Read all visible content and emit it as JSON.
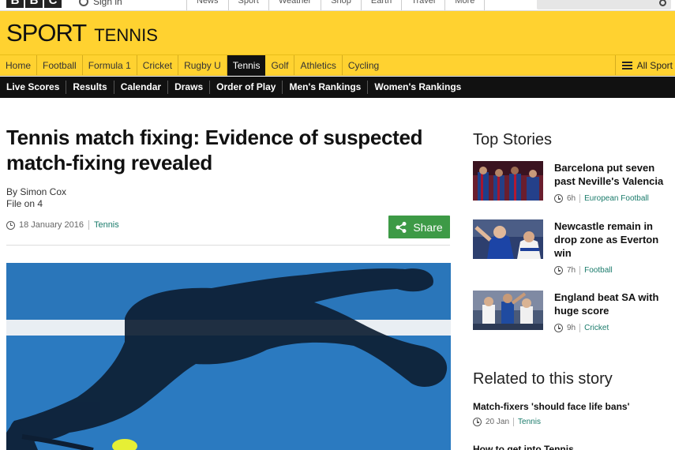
{
  "bbc_bar": {
    "logo": [
      "B",
      "B",
      "C"
    ],
    "signin": "Sign in",
    "nav": [
      "News",
      "Sport",
      "Weather",
      "Shop",
      "Earth",
      "Travel",
      "More"
    ],
    "search_placeholder": "Search"
  },
  "header": {
    "title": "SPORT",
    "section": "TENNIS"
  },
  "sport_nav": {
    "items": [
      "Home",
      "Football",
      "Formula 1",
      "Cricket",
      "Rugby U",
      "Tennis",
      "Golf",
      "Athletics",
      "Cycling"
    ],
    "active": "Tennis",
    "all_sport": "All Sport"
  },
  "sub_nav": {
    "items": [
      "Live Scores",
      "Results",
      "Calendar",
      "Draws",
      "Order of Play",
      "Men's Rankings",
      "Women's Rankings"
    ]
  },
  "article": {
    "title": "Tennis match fixing: Evidence of suspected match-fixing revealed",
    "author": "By Simon Cox",
    "programme": "File on 4",
    "date": "18 January 2016",
    "topic": "Tennis",
    "share_label": "Share"
  },
  "top_stories": {
    "heading": "Top Stories",
    "items": [
      {
        "headline": "Barcelona put seven past Neville's Valencia",
        "time": "6h",
        "topic": "European Football"
      },
      {
        "headline": "Newcastle remain in drop zone as Everton win",
        "time": "7h",
        "topic": "Football"
      },
      {
        "headline": "England beat SA with huge score",
        "time": "9h",
        "topic": "Cricket"
      }
    ]
  },
  "related": {
    "heading": "Related to this story",
    "items": [
      {
        "headline": "Match-fixers 'should face life bans'",
        "date": "20 Jan",
        "topic": "Tennis"
      },
      {
        "headline": "How to get into Tennis"
      }
    ]
  },
  "colors": {
    "sport_yellow": "#ffd230",
    "subnav_black": "#111111",
    "share_green": "#3d9a46",
    "topic_teal": "#1a7b6b",
    "court_blue": "#2d7dc4"
  }
}
